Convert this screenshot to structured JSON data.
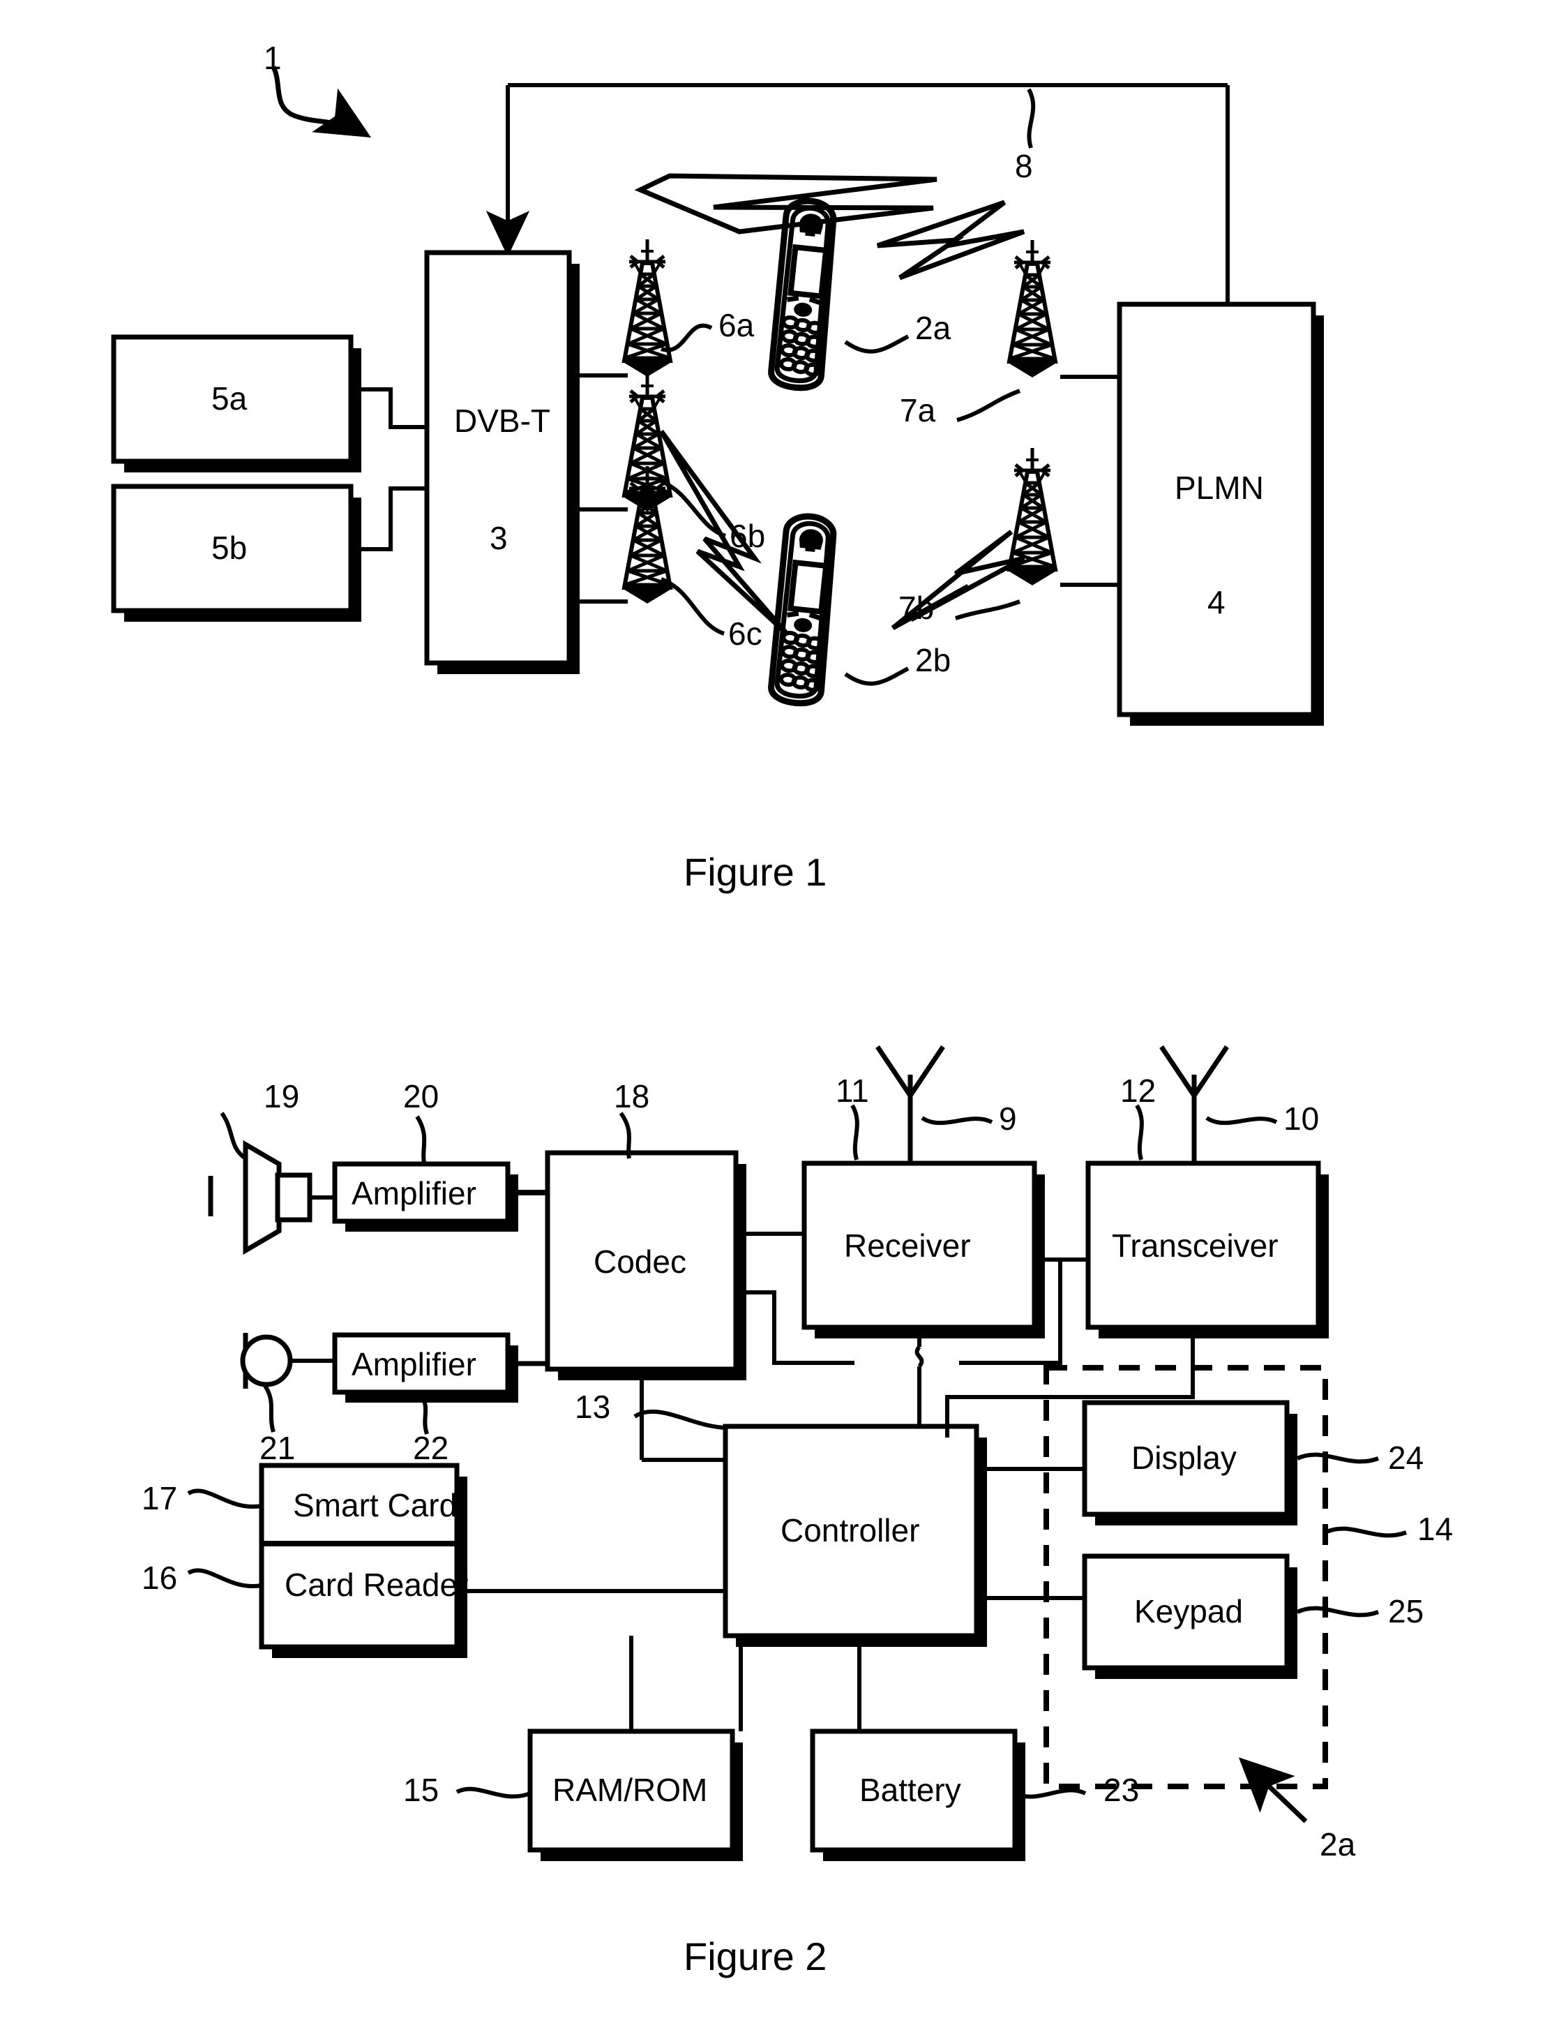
{
  "document": {
    "type": "patent-drawing-sheet",
    "figures": [
      {
        "caption": "Figure 1",
        "system_ref": "1",
        "blocks": [
          {
            "label": "5a",
            "ref": "5a",
            "name": "content-source-a"
          },
          {
            "label": "5b",
            "ref": "5b",
            "name": "content-source-b"
          },
          {
            "label": "DVB-T",
            "ref": "3",
            "name": "dvb-t-network"
          },
          {
            "label": "PLMN",
            "ref": "4",
            "name": "plmn-network"
          }
        ],
        "dvbt_title": "DVB-T",
        "dvbt_ref": "3",
        "plmn_title": "PLMN",
        "plmn_ref": "4",
        "towers": [
          {
            "ref": "6a",
            "name": "dvb-t-transmitter-6a"
          },
          {
            "ref": "6b",
            "name": "dvb-t-transmitter-6b"
          },
          {
            "ref": "6c",
            "name": "dvb-t-transmitter-6c"
          },
          {
            "ref": "7a",
            "name": "plmn-base-station-7a"
          },
          {
            "ref": "7b",
            "name": "plmn-base-station-7b"
          }
        ],
        "terminals": [
          {
            "ref": "2a",
            "name": "mobile-terminal-2a"
          },
          {
            "ref": "2b",
            "name": "mobile-terminal-2b"
          }
        ],
        "link_ref": "8"
      },
      {
        "caption": "Figure 2",
        "device_ref": "2a",
        "blocks": [
          {
            "label": "Amplifier",
            "ref": "20",
            "name": "speaker-amplifier"
          },
          {
            "label": "Amplifier",
            "ref": "22",
            "name": "microphone-amplifier"
          },
          {
            "label": "Codec",
            "ref": "18",
            "name": "codec"
          },
          {
            "label": "Receiver",
            "ref": "11",
            "name": "receiver"
          },
          {
            "label": "Transceiver",
            "ref": "12",
            "name": "transceiver"
          },
          {
            "label": "Controller",
            "ref": "13",
            "name": "controller"
          },
          {
            "label": "Smart Card",
            "ref": "17",
            "name": "smart-card"
          },
          {
            "label": "Card Reader",
            "ref": "16",
            "name": "card-reader"
          },
          {
            "label": "Display",
            "ref": "24",
            "name": "display"
          },
          {
            "label": "Keypad",
            "ref": "25",
            "name": "keypad"
          },
          {
            "label": "RAM/ROM",
            "ref": "15",
            "name": "ram-rom"
          },
          {
            "label": "Battery",
            "ref": "23",
            "name": "battery"
          }
        ],
        "speaker_ref": "19",
        "microphone_ref": "21",
        "antenna_receiver_ref": "9",
        "antenna_transceiver_ref": "10",
        "ui_group_ref": "14"
      }
    ]
  },
  "fig1": {
    "caption": "Figure 1",
    "ref_1": "1",
    "ref_5a": "5a",
    "ref_5b": "5b",
    "dvbt_label": "DVB-T",
    "dvbt_num": "3",
    "plmn_label": "PLMN",
    "plmn_num": "4",
    "ref_6a": "6a",
    "ref_6b": "6b",
    "ref_6c": "6c",
    "ref_7a": "7a",
    "ref_7b": "7b",
    "ref_2a": "2a",
    "ref_2b": "2b",
    "ref_8": "8"
  },
  "fig2": {
    "caption": "Figure 2",
    "amplifier1": "Amplifier",
    "amplifier2": "Amplifier",
    "codec": "Codec",
    "receiver": "Receiver",
    "transceiver": "Transceiver",
    "controller": "Controller",
    "smart_card": "Smart Card",
    "card_reader": "Card Reader",
    "display": "Display",
    "keypad": "Keypad",
    "ram_rom": "RAM/ROM",
    "battery": "Battery",
    "ref_19": "19",
    "ref_20": "20",
    "ref_18": "18",
    "ref_11": "11",
    "ref_9": "9",
    "ref_12": "12",
    "ref_10": "10",
    "ref_21": "21",
    "ref_22": "22",
    "ref_13": "13",
    "ref_17": "17",
    "ref_16": "16",
    "ref_24": "24",
    "ref_14": "14",
    "ref_25": "25",
    "ref_15": "15",
    "ref_23": "23",
    "ref_2a": "2a"
  },
  "colors": {
    "ink": "#000000",
    "paper": "#ffffff"
  }
}
